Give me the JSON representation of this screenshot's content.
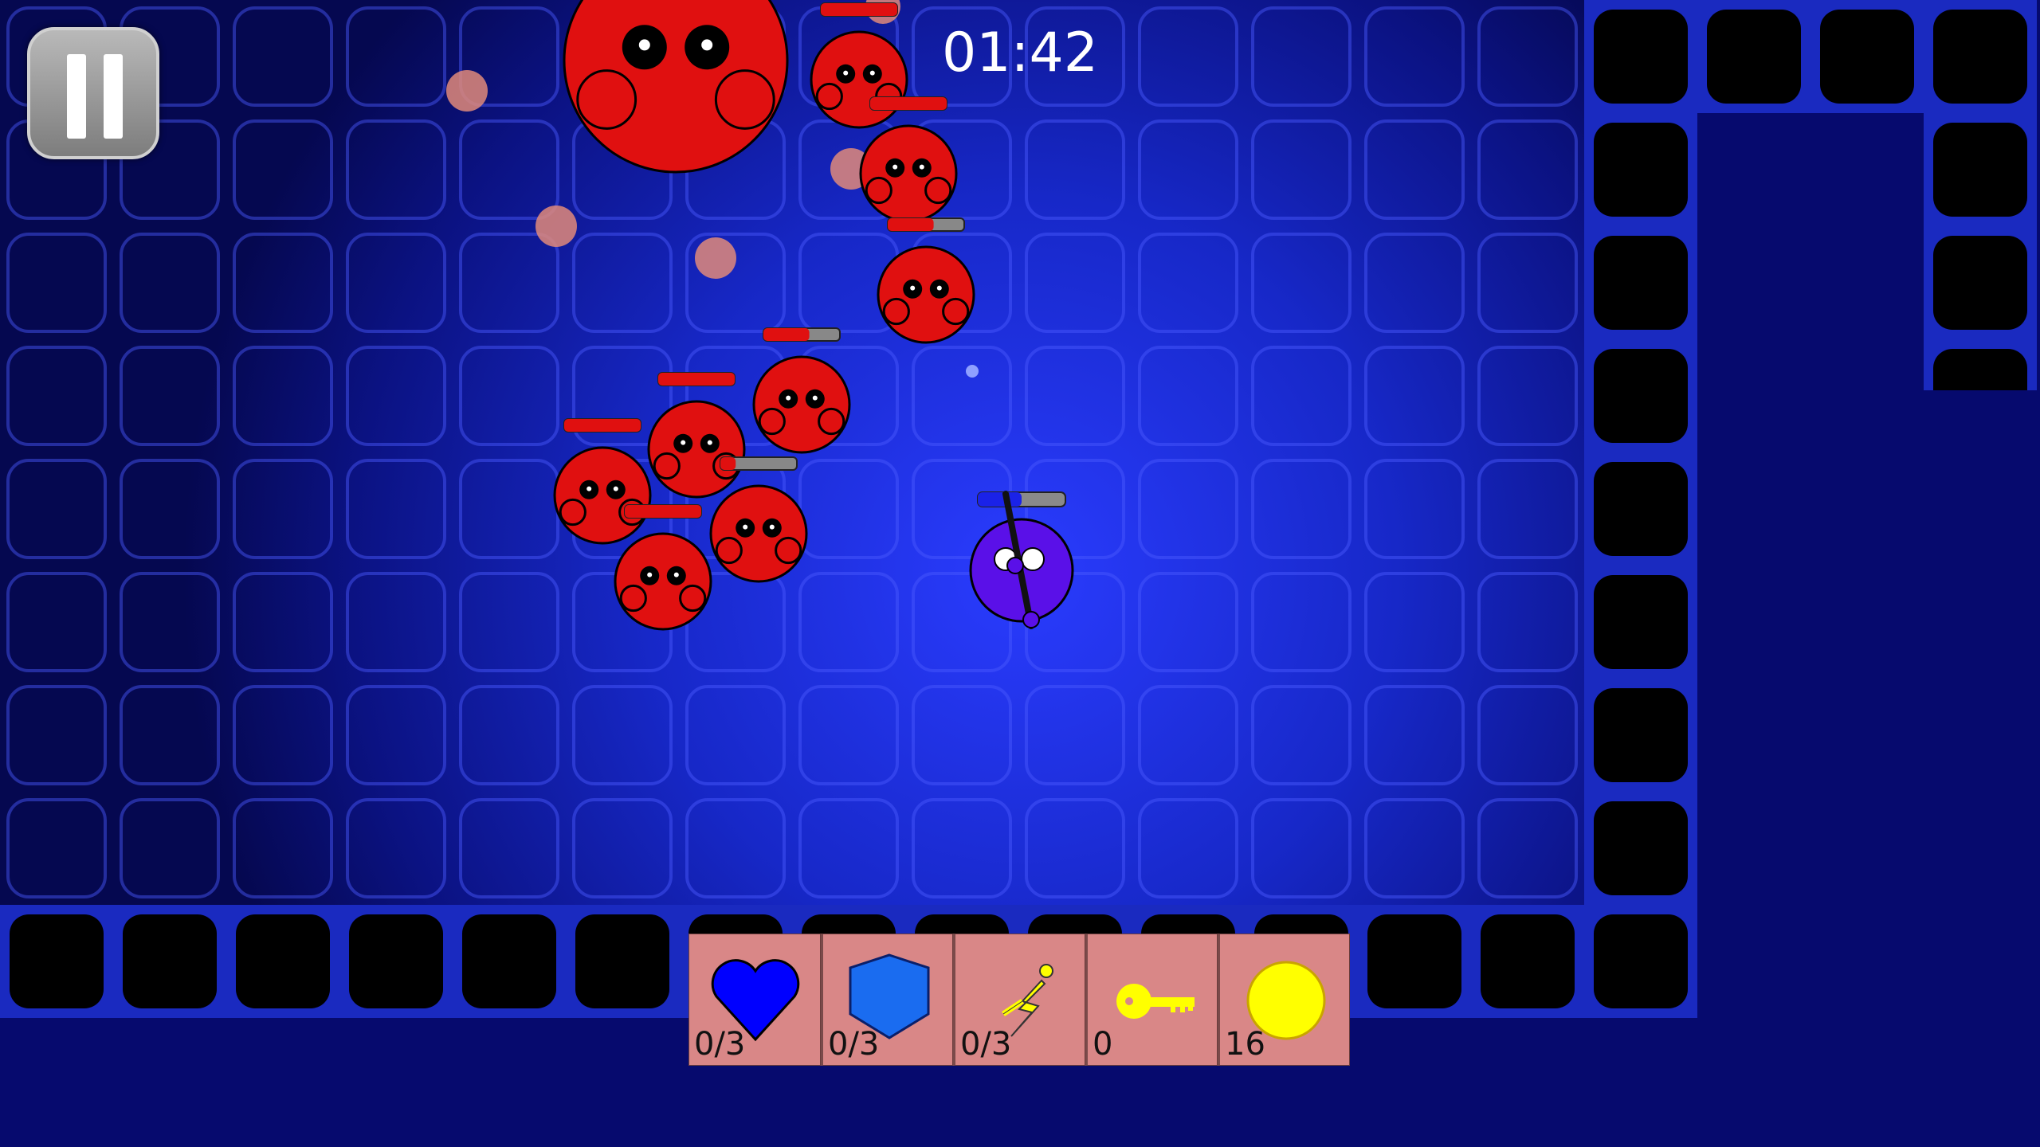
{
  "hud": {
    "timer": "01:42",
    "items": [
      {
        "name": "heart",
        "icon": "heart-icon",
        "count": "0/3",
        "color": "#0000ff"
      },
      {
        "name": "shield",
        "icon": "shield-icon",
        "count": "0/3",
        "color": "#1a6cf0"
      },
      {
        "name": "speed",
        "icon": "running-bolt-icon",
        "count": "0/3",
        "color": "#ffff00"
      },
      {
        "name": "key",
        "icon": "key-icon",
        "count": "0",
        "color": "#ffff00"
      },
      {
        "name": "coin",
        "icon": "coin-icon",
        "count": "16",
        "color": "#ffff00"
      }
    ]
  },
  "controls": {
    "pause": {
      "icon": "pause-icon"
    }
  },
  "colors": {
    "background": "#060a6e",
    "floor": "#1d2ad8",
    "enemy": "#e01010",
    "player": "#5a10e8",
    "hud_slot": "#d98787"
  },
  "enemies": {
    "count": 10,
    "boss_count": 1
  },
  "player": {
    "health_fraction": 0.5
  }
}
